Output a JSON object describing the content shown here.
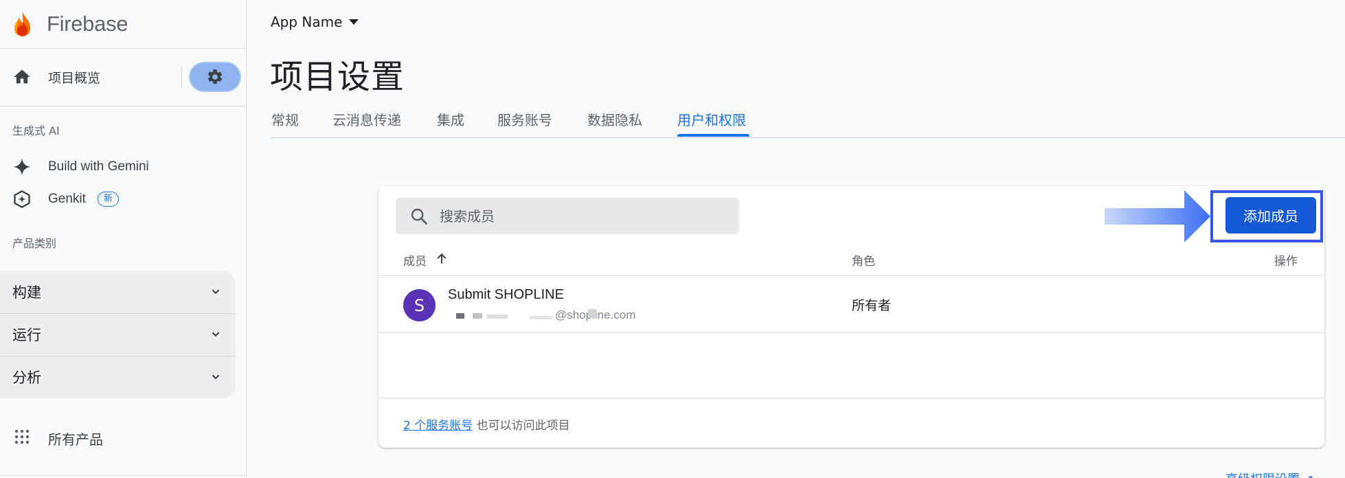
{
  "brand": {
    "name": "Firebase"
  },
  "sidebar": {
    "overview_label": "项目概览",
    "gen_ai_title": "生成式 AI",
    "gen_ai_items": [
      {
        "label": "Build with Gemini",
        "icon": "sparkle-icon"
      },
      {
        "label": "Genkit",
        "icon": "genkit-icon",
        "badge": "新"
      }
    ],
    "products_title": "产品类别",
    "categories": [
      {
        "label": "构建"
      },
      {
        "label": "运行"
      },
      {
        "label": "分析"
      }
    ],
    "all_products_label": "所有产品"
  },
  "header": {
    "app_name": "App Name",
    "page_title": "项目设置"
  },
  "tabs": [
    {
      "label": "常规",
      "active": false
    },
    {
      "label": "云消息传递",
      "active": false
    },
    {
      "label": "集成",
      "active": false
    },
    {
      "label": "服务账号",
      "active": false
    },
    {
      "label": "数据隐私",
      "active": false
    },
    {
      "label": "用户和权限",
      "active": true
    }
  ],
  "members": {
    "search_placeholder": "搜索成员",
    "add_button_label": "添加成员",
    "columns": {
      "member": "成员",
      "role": "角色",
      "actions": "操作"
    },
    "rows": [
      {
        "avatar_letter": "S",
        "name": "Submit SHOPLINE",
        "email_visible": "@shopline.com",
        "role": "所有者"
      }
    ],
    "footer_link": "2 个服务账号",
    "footer_text": " 也可以访问此项目"
  },
  "advanced_link": "高级权限设置 ↗",
  "colors": {
    "accent": "#1a73e8",
    "add_button": "#1558d6",
    "highlight_frame": "#3556e8",
    "avatar": "#5b34b5"
  }
}
